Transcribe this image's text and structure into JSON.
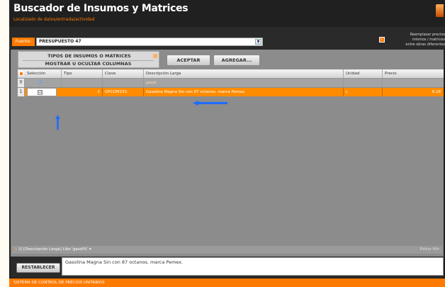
{
  "window": {
    "title": "Buscador de Insumos y Matrices",
    "subtitle": "Localizado de datos/entrada/actividad"
  },
  "toolbar": {
    "fuente_label": "Fuente:",
    "fuente_value": "PRESUPUESTO 47",
    "checkbox_label": "Reemplazar precios\nmismos / matrices\nentre obras diferentes",
    "checkbox_checked": true
  },
  "panel": {
    "tipos_line1": "TIPOS DE INSUMOS O MATRICES",
    "tipos_line2": "MOSTRAR U OCULTAR COLUMNAS",
    "aceptar_label": "ACEPTAR",
    "agregar_label": "AGREGAR..."
  },
  "grid": {
    "columns": [
      "Selección",
      "Tipo",
      "Clave",
      "Descripción Larga",
      "Unidad",
      "Precio"
    ],
    "filter_row": {
      "indicator": "∇",
      "descripcion": "gasol"
    },
    "rows": [
      {
        "indicator": "1",
        "seleccion": "☑",
        "tipo": "2",
        "clave": "GPCOM233",
        "descripcion": "Gasolina Magna Sin con 87 octanos, marca Pemex.",
        "unidad": "L",
        "precio": "6.18"
      }
    ]
  },
  "filterbar": {
    "close": "✕",
    "check": "☑",
    "text": "[Descripción Larga] Like 'gasol%'",
    "dropdown": "▾",
    "editar": "Editar filtr"
  },
  "bottom": {
    "restablecer_label": "RESTABLECER",
    "description_text": "Gasolina Magna Sin con 87 octanos, marca Pemex."
  },
  "status": {
    "text": "SISTEMA DE CONTROL DE PRECIOS UNITARIOS"
  },
  "colors": {
    "accent": "#ff7a00",
    "arrow": "#1e6bff"
  }
}
